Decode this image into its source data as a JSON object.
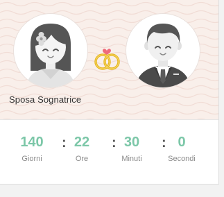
{
  "couple": {
    "bride_name": "Sposa Sognatrice"
  },
  "countdown": {
    "days": {
      "value": "140",
      "label": "Giorni"
    },
    "hours": {
      "value": "22",
      "label": "Ore"
    },
    "minutes": {
      "value": "30",
      "label": "Minuti"
    },
    "seconds": {
      "value": "0",
      "label": "Secondi"
    },
    "separator": ":"
  },
  "icons": {
    "bride": "bride-avatar-icon",
    "groom": "groom-avatar-icon",
    "rings": "wedding-rings-icon",
    "heart": "heart-icon"
  },
  "colors": {
    "accent_green": "#7cc7a8",
    "ring_gold": "#e8b923",
    "heart_pink": "#ef6a7a",
    "hero_bg": "#f9efea"
  }
}
